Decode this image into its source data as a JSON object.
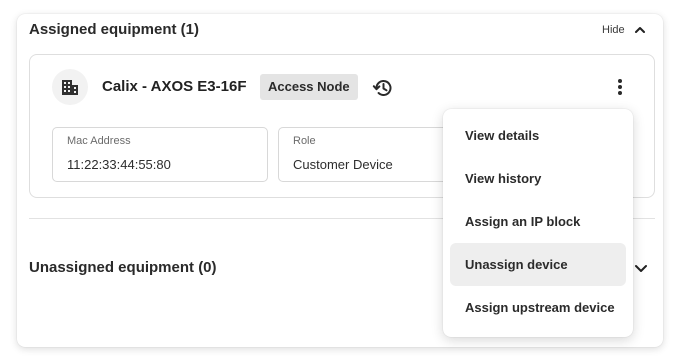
{
  "assigned": {
    "title": "Assigned equipment (1)",
    "hide_label": "Hide",
    "device": {
      "name": "Calix - AXOS E3-16F",
      "type_badge": "Access Node",
      "icon": "building-icon",
      "fields": [
        {
          "label": "Mac Address",
          "value": "11:22:33:44:55:80"
        },
        {
          "label": "Role",
          "value": "Customer Device"
        }
      ]
    }
  },
  "unassigned": {
    "title": "Unassigned equipment (0)"
  },
  "menu": {
    "items": [
      {
        "label": "View details"
      },
      {
        "label": "View history"
      },
      {
        "label": "Assign an IP block"
      },
      {
        "label": "Unassign device"
      },
      {
        "label": "Assign upstream device"
      }
    ],
    "hovered": "Unassign device"
  },
  "colors": {
    "hover": "#eeeeee",
    "badge": "#e4e4e4",
    "border": "#dedede"
  }
}
